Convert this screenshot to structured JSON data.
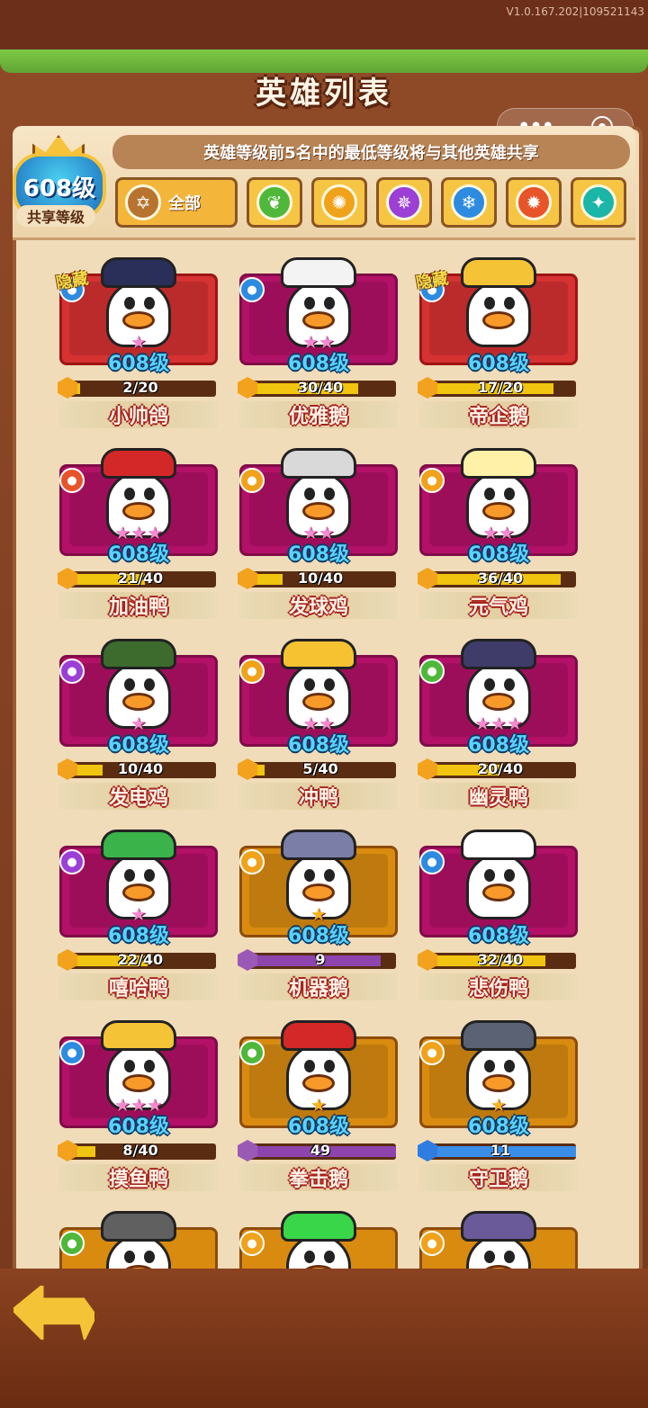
{
  "version": "V1.0.167.202|109521143",
  "title": "英雄列表",
  "share_note": "英雄等级前5名中的最低等级将与其他英雄共享",
  "shared_badge": {
    "level": "608级",
    "caption": "共享等级"
  },
  "tabs": [
    {
      "label": "全部",
      "icon": "hexagram-icon",
      "color": "#b8742f"
    },
    {
      "label": "",
      "icon": "grass-icon",
      "color": "#4fb83a"
    },
    {
      "label": "",
      "icon": "sun-icon",
      "color": "#f0a21a"
    },
    {
      "label": "",
      "icon": "vortex-icon",
      "color": "#9b3fd6"
    },
    {
      "label": "",
      "icon": "snowflake-icon",
      "color": "#2d8be0"
    },
    {
      "label": "",
      "icon": "fire-icon",
      "color": "#e8542a"
    },
    {
      "label": "",
      "icon": "crystal-icon",
      "color": "#1bb6a8"
    }
  ],
  "heroes": [
    {
      "name": "小帅鸽",
      "level": "608级",
      "progress_text": "2/20",
      "progress": 0.1,
      "stars": 1,
      "frame": "red",
      "hidden_tag": "隐藏",
      "element": "#2d8be0",
      "hat": "#2a2f5a"
    },
    {
      "name": "优雅鹅",
      "level": "608级",
      "progress_text": "30/40",
      "progress": 0.75,
      "stars": 2,
      "frame": "mag",
      "hidden_tag": "",
      "element": "#2d8be0",
      "hat": "#f3f3f3"
    },
    {
      "name": "帝企鹅",
      "level": "608级",
      "progress_text": "17/20",
      "progress": 0.85,
      "stars": 0,
      "frame": "red",
      "hidden_tag": "隐藏",
      "element": "#2d8be0",
      "hat": "#f4c336"
    },
    {
      "name": "加油鸭",
      "level": "608级",
      "progress_text": "21/40",
      "progress": 0.53,
      "stars": 3,
      "frame": "mag",
      "hidden_tag": "",
      "element": "#e8542a",
      "hat": "#d42828"
    },
    {
      "name": "发球鸡",
      "level": "608级",
      "progress_text": "10/40",
      "progress": 0.25,
      "stars": 2,
      "frame": "mag",
      "hidden_tag": "",
      "element": "#f0a21a",
      "hat": "#d9d9d9"
    },
    {
      "name": "元气鸡",
      "level": "608级",
      "progress_text": "36/40",
      "progress": 0.9,
      "stars": 2,
      "frame": "mag",
      "hidden_tag": "",
      "element": "#f0a21a",
      "hat": "#fff1a8"
    },
    {
      "name": "发电鸡",
      "level": "608级",
      "progress_text": "10/40",
      "progress": 0.25,
      "stars": 1,
      "frame": "mag",
      "hidden_tag": "",
      "element": "#9b3fd6",
      "hat": "#3c6b2d"
    },
    {
      "name": "冲鸭",
      "level": "608级",
      "progress_text": "5/40",
      "progress": 0.13,
      "stars": 2,
      "frame": "mag",
      "hidden_tag": "",
      "element": "#f0a21a",
      "hat": "#f7c232"
    },
    {
      "name": "幽灵鸭",
      "level": "608级",
      "progress_text": "20/40",
      "progress": 0.5,
      "stars": 3,
      "frame": "mag",
      "hidden_tag": "",
      "element": "#4fb83a",
      "hat": "#3f3c6a"
    },
    {
      "name": "嘻哈鸭",
      "level": "608级",
      "progress_text": "22/40",
      "progress": 0.55,
      "stars": 1,
      "frame": "mag",
      "hidden_tag": "",
      "element": "#9b3fd6",
      "hat": "#3ab34a"
    },
    {
      "name": "机器鹅",
      "level": "608级",
      "progress_text": "9",
      "progress": 0.9,
      "stars": 1,
      "frame": "gold",
      "hidden_tag": "",
      "element": "#f0a21a",
      "hat": "#7b7fa8",
      "bar": "purple"
    },
    {
      "name": "悲伤鸭",
      "level": "608级",
      "progress_text": "32/40",
      "progress": 0.8,
      "stars": 0,
      "frame": "mag",
      "hidden_tag": "",
      "element": "#2d8be0",
      "hat": "#ffffff"
    },
    {
      "name": "摸鱼鸭",
      "level": "608级",
      "progress_text": "8/40",
      "progress": 0.2,
      "stars": 3,
      "frame": "mag",
      "hidden_tag": "",
      "element": "#2d8be0",
      "hat": "#f4c336"
    },
    {
      "name": "拳击鹅",
      "level": "608级",
      "progress_text": "49",
      "progress": 1.0,
      "stars": 1,
      "frame": "gold",
      "hidden_tag": "",
      "element": "#4fb83a",
      "hat": "#d42828",
      "bar": "purple"
    },
    {
      "name": "守卫鹅",
      "level": "608级",
      "progress_text": "11",
      "progress": 1.0,
      "stars": 1,
      "frame": "gold",
      "hidden_tag": "",
      "element": "#f0a21a",
      "hat": "#5b6273",
      "bar": "blue"
    }
  ],
  "partial_row": [
    {
      "frame": "gold",
      "element": "#4fb83a",
      "hat": "#606060"
    },
    {
      "frame": "gold",
      "element": "#f0a21a",
      "hat": "#3ad64a"
    },
    {
      "frame": "gold",
      "element": "#f0a21a",
      "hat": "#6b5a9a"
    }
  ],
  "back_button": {
    "icon": "back-arrow-icon"
  }
}
